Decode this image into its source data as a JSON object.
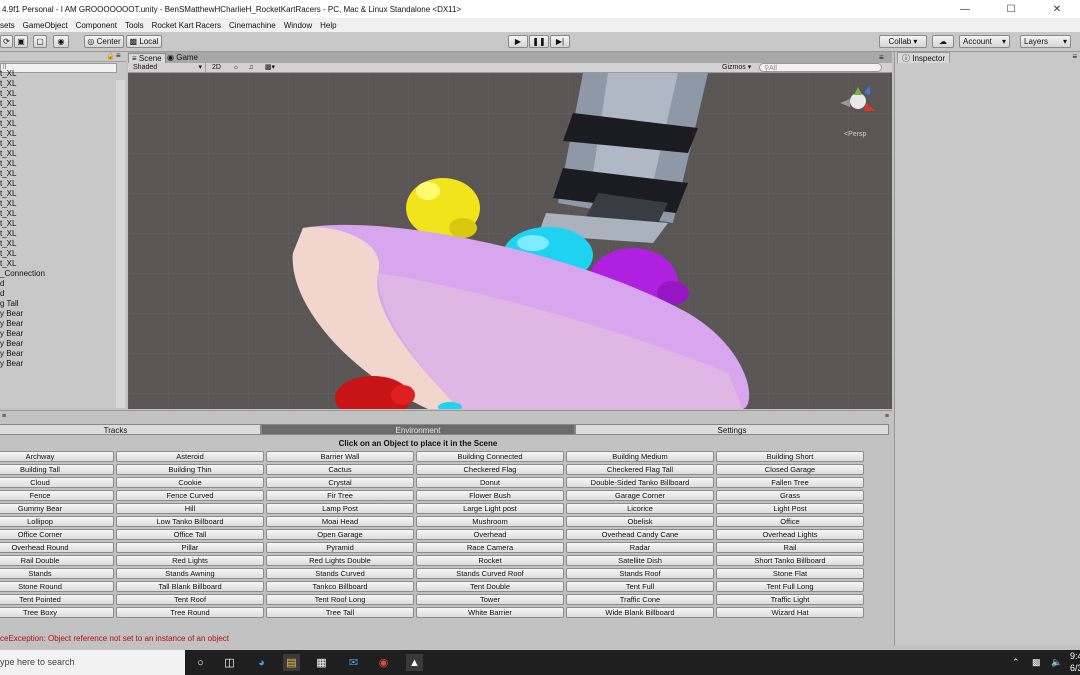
{
  "window": {
    "title": "4.9f1 Personal - I AM GROOOOOOOT.unity - BenSMatthewHCharlieH_RocketKartRacers - PC, Mac & Linux Standalone <DX11>"
  },
  "menu": [
    "sets",
    "GameObject",
    "Component",
    "Tools",
    "Rocket Kart Racers",
    "Cinemachine",
    "Window",
    "Help"
  ],
  "toolbar": {
    "pivot": "Center",
    "space": "Local",
    "collab": "Collab ▾",
    "account": "Account",
    "layers": "Layers"
  },
  "hierarchy": {
    "search_placeholder": "ll",
    "items": [
      "t_XL",
      "t_XL",
      "t_XL",
      "t_XL",
      "t_XL",
      "t_XL",
      "t_XL",
      "t_XL",
      "t_XL",
      "t_XL",
      "t_XL",
      "t_XL",
      "t_XL",
      "t_XL",
      "t_XL",
      "t_XL",
      "t_XL",
      "t_XL",
      "t_XL",
      "t_XL",
      "_Connection",
      "d",
      "d",
      "g Tall",
      "y Bear",
      "y Bear",
      "y Bear",
      "y Bear",
      "y Bear",
      "y Bear"
    ]
  },
  "scene": {
    "tab_scene": "Scene",
    "tab_game": "Game",
    "shading": "Shaded",
    "mode_2d": "2D",
    "gizmos": "Gizmos",
    "search_placeholder": "All",
    "persp": "Persp"
  },
  "inspector": {
    "tab": "Inspector"
  },
  "env": {
    "tabs": [
      "Tracks",
      "Environment",
      "Settings"
    ],
    "message": "Click on an Object to place it in the Scene",
    "buttons": [
      "Archway",
      "Asteroid",
      "Barrier Wall",
      "Building Connected",
      "Building Medium",
      "Building Short",
      "Building Tall",
      "Building Thin",
      "Cactus",
      "Checkered Flag",
      "Checkered Flag Tall",
      "Closed Garage",
      "Cloud",
      "Cookie",
      "Crystal",
      "Donut",
      "Double-Sided Tanko Billboard",
      "Fallen Tree",
      "Fence",
      "Fence Curved",
      "Fir Tree",
      "Flower Bush",
      "Garage Corner",
      "Grass",
      "Gummy Bear",
      "Hill",
      "Lamp Post",
      "Large Light post",
      "Licorice",
      "Light Post",
      "Lollipop",
      "Low Tanko Billboard",
      "Moai Head",
      "Mushroom",
      "Obelisk",
      "Office",
      "Office Corner",
      "Office Tall",
      "Open Garage",
      "Overhead",
      "Overhead Candy Cane",
      "Overhead Lights",
      "Overhead Round",
      "Pillar",
      "Pyramid",
      "Race Camera",
      "Radar",
      "Rail",
      "Rail Double",
      "Red Lights",
      "Red Lights Double",
      "Rocket",
      "Satellite Dish",
      "Short Tanko Billboard",
      "Stands",
      "Stands Awning",
      "Stands Curved",
      "Stands Curved Roof",
      "Stands Roof",
      "Stone Flat",
      "Stone Round",
      "Tall Blank Billboard",
      "Tankco Billboard",
      "Tent Double",
      "Tent Full",
      "Tent Full Long",
      "Tent Pointed",
      "Tent Roof",
      "Tent Roof Long",
      "Tower",
      "Traffic Cone",
      "Traffic Light",
      "Tree Boxy",
      "Tree Round",
      "Tree Tall",
      "White Barrier",
      "Wide Blank Billboard",
      "Wizard Hat"
    ]
  },
  "console": {
    "message": "ceException: Object reference not set to an instance of an object"
  },
  "taskbar": {
    "search": "ype here to search",
    "time": "9:4",
    "date": "6/3"
  }
}
